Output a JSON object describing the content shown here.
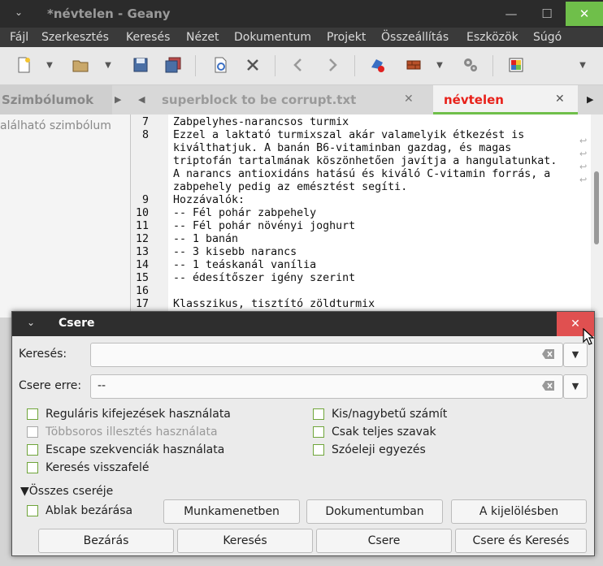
{
  "window": {
    "title": "*névtelen - Geany",
    "minimize": "—",
    "maximize": "☐",
    "close": "✕"
  },
  "menu": [
    "Fájl",
    "Szerkesztés",
    "Keresés",
    "Nézet",
    "Dokumentum",
    "Projekt",
    "Összeállítás",
    "Eszközök",
    "Súgó"
  ],
  "sidebar": {
    "tab_label": "Szimbólumok",
    "empty_text": "alálható szimbólum"
  },
  "tabs": [
    {
      "label": "superblock to be corrupt.txt",
      "color": "#9a9a9a"
    },
    {
      "label": "névtelen",
      "color": "#e8211a"
    }
  ],
  "editor": {
    "lines": [
      {
        "num": "7",
        "text": "Zabpelyhes-narancsos turmix"
      },
      {
        "num": "8",
        "text": "Ezzel a laktató turmixszal akár valamelyik étkezést is"
      },
      {
        "num": "",
        "text": "kiválthatjuk. A banán B6-vitaminban gazdag, és magas"
      },
      {
        "num": "",
        "text": "triptofán tartalmának köszönhetően javítja a hangulatunkat."
      },
      {
        "num": "",
        "text": "A narancs antioxidáns hatású és kiváló C-vitamin forrás, a"
      },
      {
        "num": "",
        "text": "zabpehely pedig az emésztést segíti."
      },
      {
        "num": "9",
        "text": "Hozzávalók:"
      },
      {
        "num": "10",
        "text": "-- Fél pohár zabpehely"
      },
      {
        "num": "11",
        "text": "-- Fél pohár növényi joghurt"
      },
      {
        "num": "12",
        "text": "-- 1 banán"
      },
      {
        "num": "13",
        "text": "-- 3 kisebb narancs"
      },
      {
        "num": "14",
        "text": "-- 1 teáskanál vanília"
      },
      {
        "num": "15",
        "text": "-- édesítőszer igény szerint"
      },
      {
        "num": "16",
        "text": ""
      },
      {
        "num": "17",
        "text": "Klasszikus, tisztító zöldturmix"
      }
    ]
  },
  "dialog": {
    "title": "Csere",
    "close": "✕",
    "search_label": "Keresés:",
    "search_value": "",
    "replace_label": "Csere erre:",
    "replace_value": "--",
    "options_left": [
      {
        "label": "Reguláris kifejezések használata",
        "disabled": false
      },
      {
        "label": "Többsoros illesztés használata",
        "disabled": true
      },
      {
        "label": "Escape szekvenciák használata",
        "disabled": false
      },
      {
        "label": "Keresés visszafelé",
        "disabled": false
      }
    ],
    "options_right": [
      {
        "label": "Kis/nagybetű számít"
      },
      {
        "label": "Csak teljes szavak"
      },
      {
        "label": "Szóeleji egyezés"
      }
    ],
    "replace_all_label": "Összes cseréje",
    "close_window_label": "Ablak bezárása",
    "in_session_button": "Munkamenetben",
    "in_document_button": "Dokumentumban",
    "in_selection_button": "A kijelölésben",
    "close_button": "Bezárás",
    "find_button": "Keresés",
    "replace_button": "Csere",
    "replace_find_button": "Csere és Keresés"
  },
  "colors": {
    "accent_green": "#6fbf4a",
    "active_tab": "#e8211a",
    "dialog_close": "#e05050"
  }
}
